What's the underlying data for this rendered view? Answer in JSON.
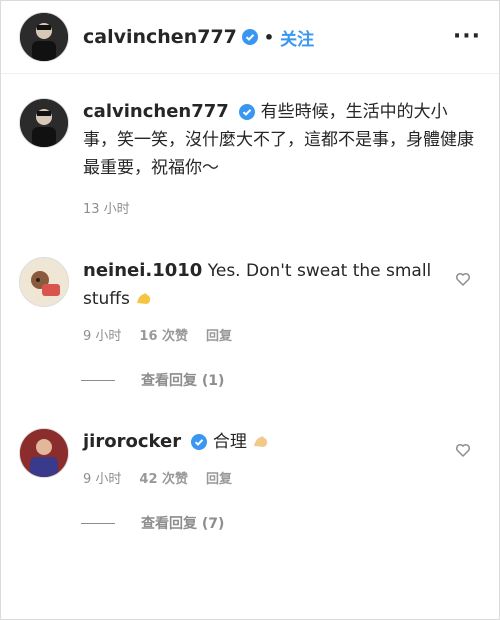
{
  "header": {
    "username": "calvinchen777",
    "separator": "•",
    "follow_label": "关注",
    "more_label": "···"
  },
  "caption": {
    "username": "calvinchen777",
    "text": "有些時候，生活中的大小事，笑一笑，沒什麼大不了，這都不是事，身體健康最重要，祝福你～",
    "time": "13 小时"
  },
  "comments": [
    {
      "username": "neinei.1010",
      "text": "Yes. Don't sweat the small stuffs",
      "time": "9 小时",
      "likes": "16 次赞",
      "reply_label": "回复",
      "view_replies": "查看回复 (1)"
    },
    {
      "username": "jirorocker",
      "text": "合理",
      "time": "9 小时",
      "likes": "42 次赞",
      "reply_label": "回复",
      "view_replies": "查看回复 (7)"
    }
  ],
  "colors": {
    "accent": "#3897f0",
    "verified": "#3897f0",
    "muted": "#8e8e8e"
  },
  "icons": {
    "verified": "verified-badge-icon",
    "heart": "heart-outline-icon",
    "emoji": "flexed-biceps-emoji"
  }
}
